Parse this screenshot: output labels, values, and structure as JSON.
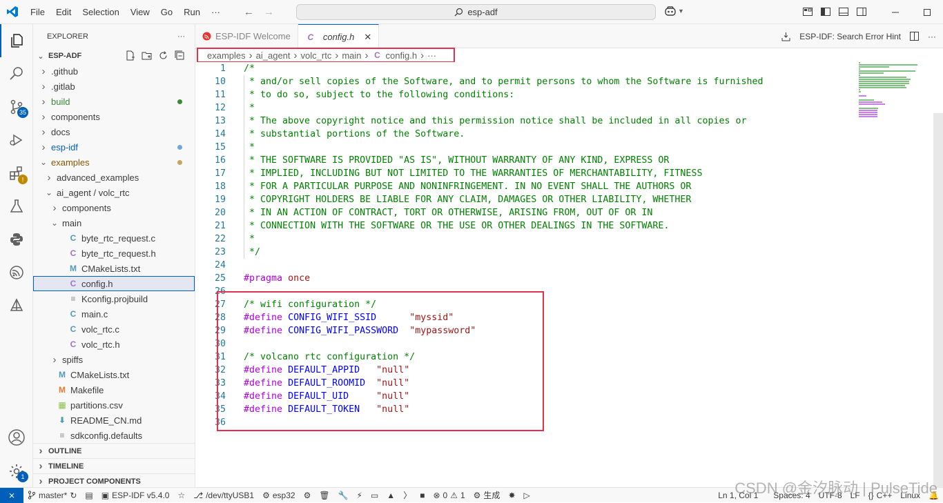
{
  "titlebar": {
    "menu": [
      "File",
      "Edit",
      "Selection",
      "View",
      "Go",
      "Run",
      "···"
    ],
    "search_text": "esp-adf"
  },
  "activity": {
    "source_control_badge": "35",
    "settings_badge": "1"
  },
  "sidebar": {
    "title": "EXPLORER",
    "more": "···",
    "root": "ESP-ADF",
    "tree": [
      {
        "label": ".github",
        "depth": 1,
        "kind": "folder",
        "open": false
      },
      {
        "label": ".gitlab",
        "depth": 1,
        "kind": "folder",
        "open": false
      },
      {
        "label": "build",
        "depth": 1,
        "kind": "folder",
        "open": false,
        "status": "green"
      },
      {
        "label": "components",
        "depth": 1,
        "kind": "folder",
        "open": false
      },
      {
        "label": "docs",
        "depth": 1,
        "kind": "folder",
        "open": false
      },
      {
        "label": "esp-idf",
        "depth": 1,
        "kind": "folder",
        "open": false,
        "status": "blue"
      },
      {
        "label": "examples",
        "depth": 1,
        "kind": "folder",
        "open": true,
        "status": "amber"
      },
      {
        "label": "advanced_examples",
        "depth": 2,
        "kind": "folder",
        "open": false
      },
      {
        "label": "ai_agent / volc_rtc",
        "depth": 2,
        "kind": "folder",
        "open": true
      },
      {
        "label": "components",
        "depth": 3,
        "kind": "folder",
        "open": false
      },
      {
        "label": "main",
        "depth": 3,
        "kind": "folder",
        "open": true
      },
      {
        "label": "byte_rtc_request.c",
        "depth": 4,
        "kind": "c"
      },
      {
        "label": "byte_rtc_request.h",
        "depth": 4,
        "kind": "h"
      },
      {
        "label": "CMakeLists.txt",
        "depth": 4,
        "kind": "cmake"
      },
      {
        "label": "config.h",
        "depth": 4,
        "kind": "h",
        "selected": true
      },
      {
        "label": "Kconfig.projbuild",
        "depth": 4,
        "kind": "plain"
      },
      {
        "label": "main.c",
        "depth": 4,
        "kind": "c"
      },
      {
        "label": "volc_rtc.c",
        "depth": 4,
        "kind": "c"
      },
      {
        "label": "volc_rtc.h",
        "depth": 4,
        "kind": "h"
      },
      {
        "label": "spiffs",
        "depth": 3,
        "kind": "folder",
        "open": false
      },
      {
        "label": "CMakeLists.txt",
        "depth": 2,
        "kind": "cmake"
      },
      {
        "label": "Makefile",
        "depth": 2,
        "kind": "make"
      },
      {
        "label": "partitions.csv",
        "depth": 2,
        "kind": "csv"
      },
      {
        "label": "README_CN.md",
        "depth": 2,
        "kind": "md"
      },
      {
        "label": "sdkconfig.defaults",
        "depth": 2,
        "kind": "plain"
      }
    ],
    "sections": [
      "OUTLINE",
      "TIMELINE",
      "PROJECT COMPONENTS"
    ]
  },
  "tabs": {
    "items": [
      {
        "label": "ESP-IDF Welcome",
        "active": false
      },
      {
        "label": "config.h",
        "active": true
      }
    ],
    "hint": "ESP-IDF: Search Error Hint"
  },
  "breadcrumb": [
    "examples",
    "ai_agent",
    "volc_rtc",
    "main",
    "config.h",
    "···"
  ],
  "code": [
    {
      "n": "1",
      "t": [
        [
          "comment",
          "/*"
        ]
      ]
    },
    {
      "n": "10",
      "t": [
        [
          "comment",
          " * and/or sell copies of the Software, and to permit persons to whom the Software is furnished"
        ]
      ]
    },
    {
      "n": "11",
      "t": [
        [
          "comment",
          " * to do so, subject to the following conditions:"
        ]
      ]
    },
    {
      "n": "12",
      "t": [
        [
          "comment",
          " *"
        ]
      ]
    },
    {
      "n": "13",
      "t": [
        [
          "comment",
          " * The above copyright notice and this permission notice shall be included in all copies or"
        ]
      ]
    },
    {
      "n": "14",
      "t": [
        [
          "comment",
          " * substantial portions of the Software."
        ]
      ]
    },
    {
      "n": "15",
      "t": [
        [
          "comment",
          " *"
        ]
      ]
    },
    {
      "n": "16",
      "t": [
        [
          "comment",
          " * THE SOFTWARE IS PROVIDED \"AS IS\", WITHOUT WARRANTY OF ANY KIND, EXPRESS OR"
        ]
      ]
    },
    {
      "n": "17",
      "t": [
        [
          "comment",
          " * IMPLIED, INCLUDING BUT NOT LIMITED TO THE WARRANTIES OF MERCHANTABILITY, FITNESS"
        ]
      ]
    },
    {
      "n": "18",
      "t": [
        [
          "comment",
          " * FOR A PARTICULAR PURPOSE AND NONINFRINGEMENT. IN NO EVENT SHALL THE AUTHORS OR"
        ]
      ]
    },
    {
      "n": "19",
      "t": [
        [
          "comment",
          " * COPYRIGHT HOLDERS BE LIABLE FOR ANY CLAIM, DAMAGES OR OTHER LIABILITY, WHETHER"
        ]
      ]
    },
    {
      "n": "20",
      "t": [
        [
          "comment",
          " * IN AN ACTION OF CONTRACT, TORT OR OTHERWISE, ARISING FROM, OUT OF OR IN"
        ]
      ]
    },
    {
      "n": "21",
      "t": [
        [
          "comment",
          " * CONNECTION WITH THE SOFTWARE OR THE USE OR OTHER DEALINGS IN THE SOFTWARE."
        ]
      ]
    },
    {
      "n": "22",
      "t": [
        [
          "comment",
          " *"
        ]
      ]
    },
    {
      "n": "23",
      "t": [
        [
          "comment",
          " */"
        ]
      ]
    },
    {
      "n": "24",
      "t": []
    },
    {
      "n": "25",
      "t": [
        [
          "pp",
          "#pragma"
        ],
        [
          "plain",
          " "
        ],
        [
          "str",
          "once"
        ]
      ]
    },
    {
      "n": "26",
      "t": []
    },
    {
      "n": "27",
      "t": [
        [
          "comment",
          "/* wifi configuration */"
        ]
      ]
    },
    {
      "n": "28",
      "t": [
        [
          "pp",
          "#define"
        ],
        [
          "plain",
          " "
        ],
        [
          "ident",
          "CONFIG_WIFI_SSID"
        ],
        [
          "plain",
          "      "
        ],
        [
          "str",
          "\"myssid\""
        ]
      ]
    },
    {
      "n": "29",
      "t": [
        [
          "pp",
          "#define"
        ],
        [
          "plain",
          " "
        ],
        [
          "ident",
          "CONFIG_WIFI_PASSWORD"
        ],
        [
          "plain",
          "  "
        ],
        [
          "str",
          "\"mypassword\""
        ]
      ]
    },
    {
      "n": "30",
      "t": []
    },
    {
      "n": "31",
      "t": [
        [
          "comment",
          "/* volcano rtc configuration */"
        ]
      ]
    },
    {
      "n": "32",
      "t": [
        [
          "pp",
          "#define"
        ],
        [
          "plain",
          " "
        ],
        [
          "ident",
          "DEFAULT_APPID"
        ],
        [
          "plain",
          "   "
        ],
        [
          "str",
          "\"null\""
        ]
      ]
    },
    {
      "n": "33",
      "t": [
        [
          "pp",
          "#define"
        ],
        [
          "plain",
          " "
        ],
        [
          "ident",
          "DEFAULT_ROOMID"
        ],
        [
          "plain",
          "  "
        ],
        [
          "str",
          "\"null\""
        ]
      ]
    },
    {
      "n": "34",
      "t": [
        [
          "pp",
          "#define"
        ],
        [
          "plain",
          " "
        ],
        [
          "ident",
          "DEFAULT_UID"
        ],
        [
          "plain",
          "     "
        ],
        [
          "str",
          "\"null\""
        ]
      ]
    },
    {
      "n": "35",
      "t": [
        [
          "pp",
          "#define"
        ],
        [
          "plain",
          " "
        ],
        [
          "ident",
          "DEFAULT_TOKEN"
        ],
        [
          "plain",
          "   "
        ],
        [
          "str",
          "\"null\""
        ]
      ]
    },
    {
      "n": "36",
      "t": []
    }
  ],
  "statusbar": {
    "branch": "master*",
    "idf_version": "ESP-IDF v5.4.0",
    "port": "/dev/ttyUSB1",
    "target": "esp32",
    "errors": "0",
    "warnings": "1",
    "build": "生成",
    "position": "Ln 1, Col 1",
    "spaces": "Spaces: 4",
    "encoding": "UTF-8",
    "eol": "LF",
    "language": "C++",
    "platform": "Linux"
  },
  "watermark": "CSDN @金汐脉动 | PulseTide",
  "colors": {
    "accent": "#005fb8",
    "highlight_box": "#e3304f",
    "comment": "#008000",
    "preprocessor": "#af00db",
    "string": "#a31515"
  }
}
